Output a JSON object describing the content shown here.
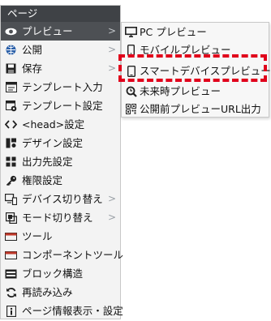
{
  "menu": {
    "header": "ページ",
    "items": [
      {
        "label": "プレビュー",
        "icon": "eye-icon",
        "arrow": ">"
      },
      {
        "label": "公開",
        "icon": "globe-icon",
        "arrow": ">"
      },
      {
        "label": "保存",
        "icon": "save-icon",
        "arrow": ">"
      },
      {
        "label": "テンプレート入力",
        "icon": "template-input-icon"
      },
      {
        "label": "テンプレート設定",
        "icon": "template-settings-icon"
      },
      {
        "label": "<head>設定",
        "icon": "code-icon"
      },
      {
        "label": "デザイン設定",
        "icon": "design-icon"
      },
      {
        "label": "出力先設定",
        "icon": "output-icon"
      },
      {
        "label": "権限設定",
        "icon": "key-icon"
      },
      {
        "label": "デバイス切り替え",
        "icon": "device-switch-icon",
        "arrow": ">"
      },
      {
        "label": "モード切り替え",
        "icon": "mode-switch-icon",
        "arrow": ">"
      },
      {
        "label": "ツール",
        "icon": "tool-icon"
      },
      {
        "label": "コンポーネントツール",
        "icon": "component-tool-icon"
      },
      {
        "label": "ブロック構造",
        "icon": "block-structure-icon"
      },
      {
        "label": "再読み込み",
        "icon": "reload-icon"
      },
      {
        "label": "ページ情報表示・設定",
        "icon": "info-icon"
      }
    ]
  },
  "submenu": {
    "items": [
      {
        "label": "PC プレビュー",
        "icon": "monitor-icon"
      },
      {
        "label": "モバイルプレビュー",
        "icon": "mobile-icon"
      },
      {
        "label": "スマートデバイスプレビュー",
        "icon": "smart-device-icon"
      },
      {
        "label": "未来時プレビュー",
        "icon": "future-search-icon"
      },
      {
        "label": "公開前プレビューURL出力",
        "icon": "qr-code-icon"
      }
    ]
  },
  "colors": {
    "highlight": "#e0001b",
    "header_bg": "#3f4246",
    "active_bg": "#4d5054"
  }
}
